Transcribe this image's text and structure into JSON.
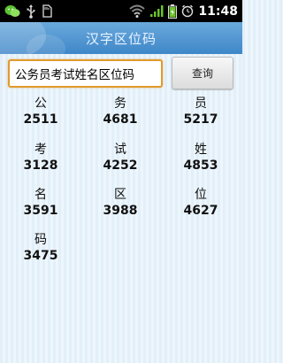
{
  "status_bar": {
    "time": "11:48",
    "icons": [
      "wechat-icon",
      "usb-icon",
      "sd-card-icon",
      "wifi-icon",
      "signal-icon",
      "battery-icon",
      "alarm-icon"
    ]
  },
  "title_bar": {
    "title": "汉字区位码"
  },
  "search": {
    "value": "公务员考试姓名区位码",
    "button_label": "查询"
  },
  "results": [
    {
      "char": "公",
      "code": "2511"
    },
    {
      "char": "务",
      "code": "4681"
    },
    {
      "char": "员",
      "code": "5217"
    },
    {
      "char": "考",
      "code": "3128"
    },
    {
      "char": "试",
      "code": "4252"
    },
    {
      "char": "姓",
      "code": "4853"
    },
    {
      "char": "名",
      "code": "3591"
    },
    {
      "char": "区",
      "code": "3988"
    },
    {
      "char": "位",
      "code": "4627"
    },
    {
      "char": "码",
      "code": "3475"
    }
  ],
  "colors": {
    "title_bar_top": "#6aa9dc",
    "title_bar_bottom": "#3f87c8",
    "input_border": "#e29a2c",
    "background": "#e6f2fb"
  }
}
